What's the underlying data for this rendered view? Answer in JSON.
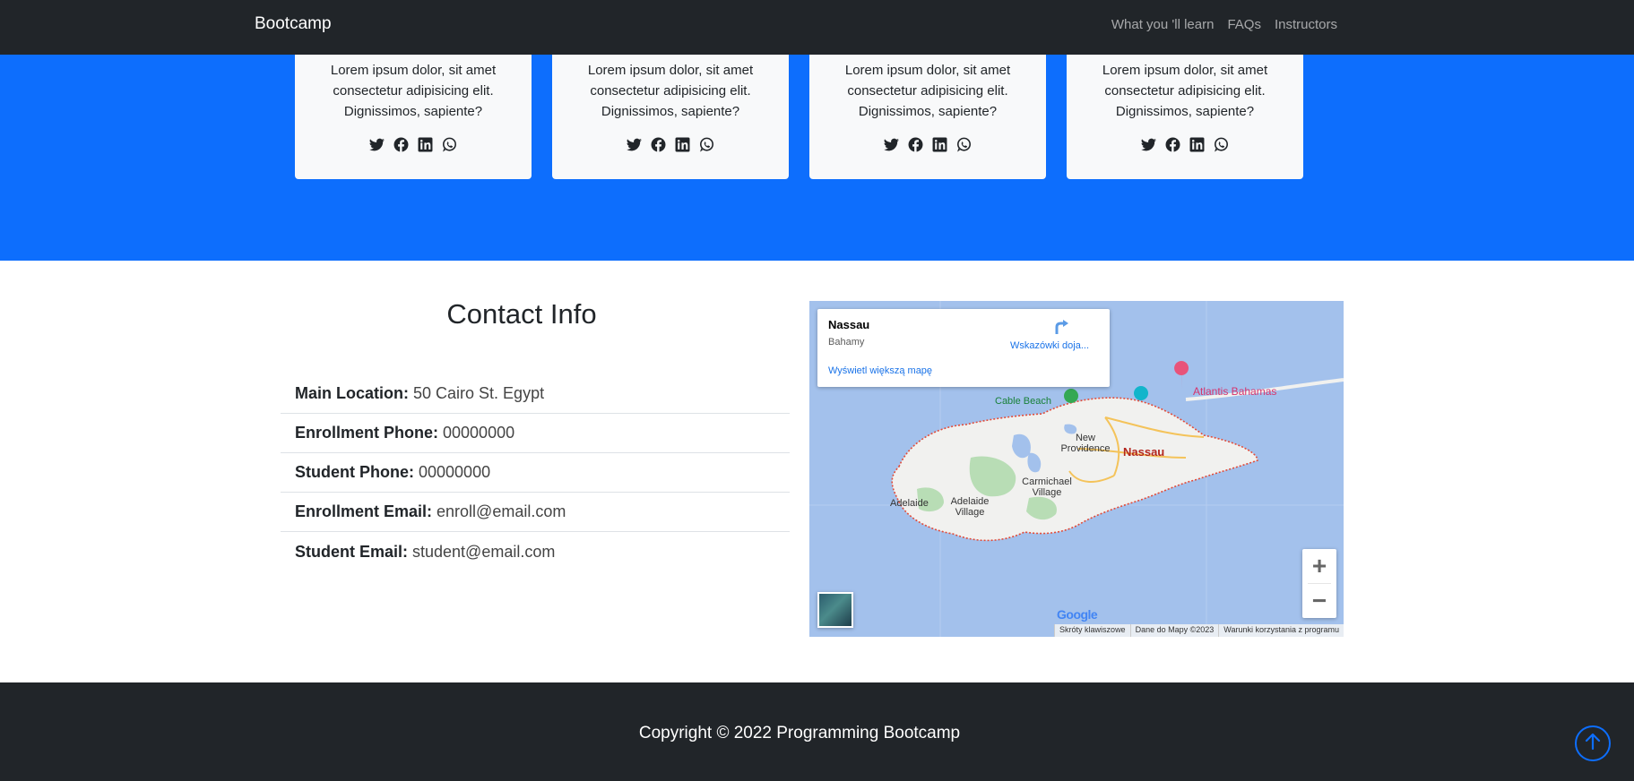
{
  "navbar": {
    "brand": "Bootcamp",
    "links": [
      "What you 'll learn",
      "FAQs",
      "Instructors"
    ]
  },
  "instructors": {
    "cards": [
      {
        "text": "Lorem ipsum dolor, sit amet consectetur adipisicing elit. Dignissimos, sapiente?",
        "icons": [
          "twitter-icon",
          "facebook-icon",
          "linkedin-icon",
          "whatsapp-icon"
        ]
      },
      {
        "text": "Lorem ipsum dolor, sit amet consectetur adipisicing elit. Dignissimos, sapiente?",
        "icons": [
          "twitter-icon",
          "facebook-icon",
          "linkedin-icon",
          "whatsapp-icon"
        ]
      },
      {
        "text": "Lorem ipsum dolor, sit amet consectetur adipisicing elit. Dignissimos, sapiente?",
        "icons": [
          "twitter-icon",
          "facebook-icon",
          "linkedin-icon",
          "whatsapp-icon"
        ]
      },
      {
        "text": "Lorem ipsum dolor, sit amet consectetur adipisicing elit. Dignissimos, sapiente?",
        "icons": [
          "twitter-icon",
          "facebook-icon",
          "linkedin-icon",
          "whatsapp-icon"
        ]
      }
    ],
    "accent_color": "#0d6efd"
  },
  "contact": {
    "title": "Contact Info",
    "items": [
      {
        "label": "Main Location:",
        "value": "50 Cairo St. Egypt"
      },
      {
        "label": "Enrollment Phone:",
        "value": "00000000"
      },
      {
        "label": "Student Phone:",
        "value": "00000000"
      },
      {
        "label": "Enrollment Email:",
        "value": "enroll@email.com"
      },
      {
        "label": "Student Email:",
        "value": "student@email.com"
      }
    ]
  },
  "map": {
    "place": "Nassau",
    "country": "Bahamy",
    "directions_label": "Wskazówki doja...",
    "bigger_map_link": "Wyświetl większą mapę",
    "labels": {
      "cable_beach": "Cable Beach",
      "atlantis": "Atlantis Bahamas",
      "new_providence": "New Providence",
      "nassau": "Nassau",
      "carmichael": "Carmichael Village",
      "adelaide": "Adelaide",
      "adelaide_village": "Adelaide Village"
    },
    "zoom_in": "+",
    "zoom_out": "−",
    "google": "Google",
    "footer": [
      "Skróty klawiszowe",
      "Dane do Mapy ©2023",
      "Warunki korzystania z programu"
    ]
  },
  "footer": {
    "copyright": "Copyright © 2022 Programming Bootcamp"
  }
}
